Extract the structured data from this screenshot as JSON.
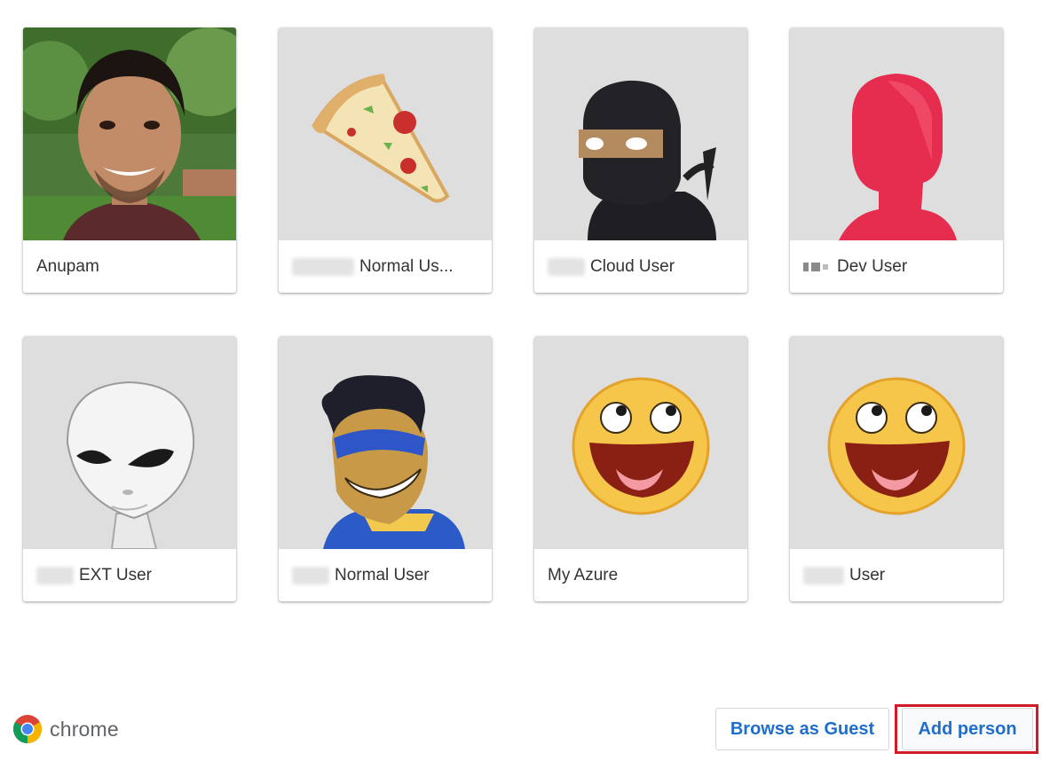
{
  "profiles": [
    {
      "name": "Anupam",
      "avatar": "photo-avatar",
      "blurred_prefix": false
    },
    {
      "name": "Normal Us...",
      "avatar": "pizza-avatar",
      "blurred_prefix": true
    },
    {
      "name": "Cloud User",
      "avatar": "ninja-avatar",
      "blurred_prefix": true
    },
    {
      "name": "Dev User",
      "avatar": "red-silhouette-avatar",
      "blurred_prefix": true
    },
    {
      "name": "EXT User",
      "avatar": "alien-avatar",
      "blurred_prefix": true
    },
    {
      "name": "Normal User",
      "avatar": "superhero-avatar",
      "blurred_prefix": true
    },
    {
      "name": "My Azure",
      "avatar": "smiley-avatar",
      "blurred_prefix": false
    },
    {
      "name": "User",
      "avatar": "smiley-avatar",
      "blurred_prefix": true
    }
  ],
  "footer": {
    "logo_text": "chrome",
    "browse_guest_label": "Browse as Guest",
    "add_person_label": "Add person"
  },
  "colors": {
    "accent": "#1f6ec9",
    "highlight": "#d31b27",
    "avatar_bg": "#dedede"
  }
}
